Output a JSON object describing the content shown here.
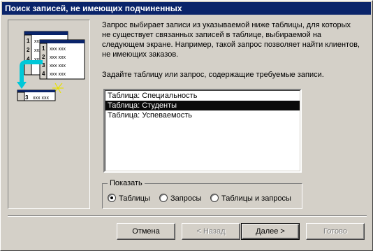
{
  "window": {
    "title": "Поиск записей, не имеющих подчиненных"
  },
  "description": "Запрос выбирает записи из указываемой ниже таблицы, для которых не существует связанных записей в таблице, выбираемой на следующем экране. Например, такой запрос позволяет найти клиентов, не имеющих заказов.",
  "prompt": "Задайте таблицу или запрос, содержащие требуемые записи.",
  "list": {
    "items": [
      {
        "label": "Таблица: Специальность",
        "selected": false
      },
      {
        "label": "Таблица: Студенты",
        "selected": true
      },
      {
        "label": "Таблица: Успеваемость",
        "selected": false
      }
    ]
  },
  "show_group": {
    "legend": "Показать",
    "options": [
      {
        "label": "Таблицы",
        "checked": true
      },
      {
        "label": "Запросы",
        "checked": false
      },
      {
        "label": "Таблицы и запросы",
        "checked": false
      }
    ]
  },
  "buttons": {
    "cancel": "Отмена",
    "back": "< Назад",
    "next": "Далее >",
    "finish": "Готово"
  },
  "illustration": {
    "table_back_rows": [
      "1",
      "2",
      "4"
    ],
    "table_front_rows": [
      "1",
      "2",
      "3",
      "4"
    ],
    "result_row": "3",
    "cell_text": "xxx"
  },
  "colors": {
    "titlebar": "#0a246a",
    "selection": "#0a0a0a",
    "arrow": "#00c8d8"
  }
}
